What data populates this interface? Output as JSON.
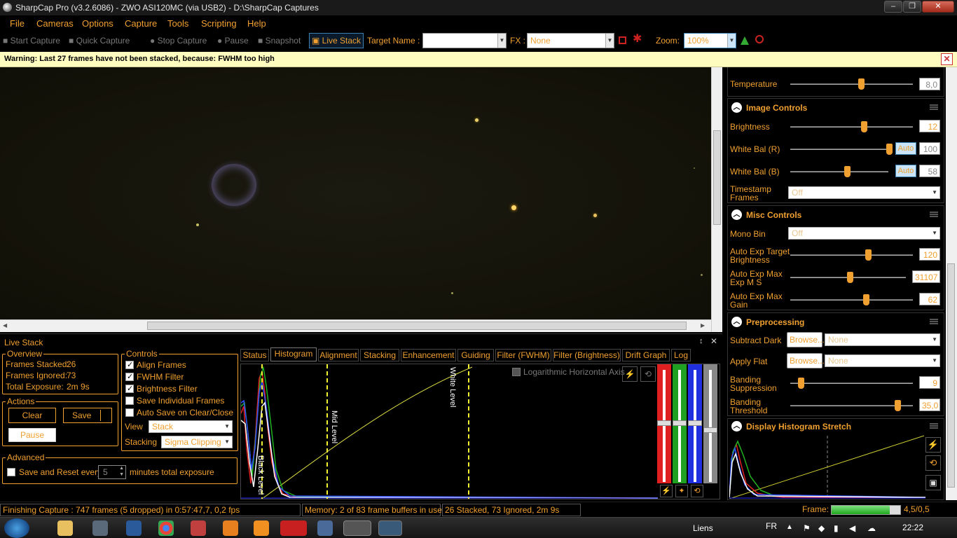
{
  "window": {
    "title": "SharpCap Pro (v3.2.6086) - ZWO ASI120MC (via USB2) - D:\\SharpCap Captures",
    "minimize": "–",
    "maximize": "❐",
    "close": "✕"
  },
  "menu": [
    "File",
    "Cameras",
    "Options",
    "Capture",
    "Tools",
    "Scripting",
    "Help"
  ],
  "toolbar": {
    "start_capture": "Start Capture",
    "quick_capture": "Quick Capture",
    "stop_capture": "Stop Capture",
    "pause": "Pause",
    "snapshot": "Snapshot",
    "live_stack": "Live Stack",
    "target_label": "Target Name :",
    "target_value": "",
    "fx_label": "FX :",
    "fx_value": "None",
    "zoom_label": "Zoom:",
    "zoom_value": "100%"
  },
  "warning": {
    "text": "Warning: Last 27 frames have not been stacked, because: FWHM too high",
    "close": "✕"
  },
  "camera_controls": {
    "temperature": {
      "label": "Temperature",
      "value": "8,0",
      "level": 0.57
    },
    "image_controls": {
      "title": "Image Controls",
      "brightness": {
        "label": "Brightness",
        "value": "12",
        "level": 0.6
      },
      "wb_r": {
        "label": "White Bal (R)",
        "value": "100",
        "auto": "Auto",
        "level": 0.98
      },
      "wb_b": {
        "label": "White Bal (B)",
        "value": "58",
        "auto": "Auto",
        "level": 0.57
      },
      "timestamp": {
        "label1": "Timestamp",
        "label2": "Frames",
        "value": "Off"
      }
    },
    "misc_controls": {
      "title": "Misc Controls",
      "mono_bin": {
        "label": "Mono Bin",
        "value": "Off"
      },
      "auto_exp_target": {
        "label1": "Auto Exp Target",
        "label2": "Brightness",
        "value": "120",
        "level": 0.64
      },
      "auto_exp_max_exp": {
        "label1": "Auto Exp Max",
        "label2": "Exp M S",
        "value": "31107",
        "level": 0.5
      },
      "auto_exp_max_gain": {
        "label1": "Auto Exp Max",
        "label2": "Gain",
        "value": "62",
        "level": 0.62
      }
    },
    "preprocessing": {
      "title": "Preprocessing",
      "subtract_dark": {
        "label": "Subtract Dark",
        "browse": "Browse...",
        "value": "None"
      },
      "apply_flat": {
        "label": "Apply Flat",
        "browse": "Browse...",
        "value": "None"
      },
      "banding_suppression": {
        "label1": "Banding",
        "label2": "Suppression",
        "value": "9",
        "level": 0.08
      },
      "banding_threshold": {
        "label1": "Banding",
        "label2": "Threshold",
        "value": "35,0",
        "level": 0.85
      }
    },
    "display_stretch": {
      "title": "Display Histogram Stretch"
    }
  },
  "live_stack": {
    "title": "Live Stack",
    "pin": "↕",
    "close": "✕",
    "overview": {
      "title": "Overview",
      "frames_stacked_label": "Frames Stacked:",
      "frames_stacked": "26",
      "frames_ignored_label": "Frames Ignored:",
      "frames_ignored": "73",
      "total_exposure_label": "Total Exposure:",
      "total_exposure": "2m 9s"
    },
    "actions": {
      "title": "Actions",
      "clear": "Clear",
      "save": "Save",
      "pause": "Pause"
    },
    "controls": {
      "title": "Controls",
      "align_frames": "Align Frames",
      "fwhm_filter": "FWHM Filter",
      "brightness_filter": "Brightness Filter",
      "save_individual": "Save Individual Frames",
      "auto_save": "Auto Save on Clear/Close",
      "view_label": "View",
      "view_value": "Stack",
      "stacking_label": "Stacking",
      "stacking_value": "Sigma Clipping"
    },
    "advanced": {
      "title": "Advanced",
      "save_reset_label": "Save and Reset every",
      "minutes_value": "5",
      "minutes_label": "minutes total exposure"
    },
    "tabs": [
      "Status",
      "Histogram",
      "Alignment",
      "Stacking",
      "Enhancement",
      "Guiding",
      "Filter (FWHM)",
      "Filter (Brightness)",
      "Drift Graph",
      "Log"
    ],
    "histogram": {
      "log_axis": "Logarithmic Horizontal Axis",
      "black_level": "Black Level",
      "mid_level": "Mid Level",
      "white_level": "White Level"
    }
  },
  "status": {
    "capture": "Finishing Capture : 747 frames (5 dropped) in 0:57:47,7, 0,2 fps",
    "memory": "Memory: 2 of 83 frame buffers in use",
    "stacked": "26 Stacked, 73 Ignored, 2m 9s",
    "frame_label": "Frame:",
    "frame_value": "4,5/0,5",
    "frame_progress": 0.85
  },
  "taskbar": {
    "links": "Liens",
    "lang": "FR",
    "time": "22:22"
  },
  "colors": {
    "accent": "#f0a030",
    "warning_bg": "#fffcc0"
  }
}
